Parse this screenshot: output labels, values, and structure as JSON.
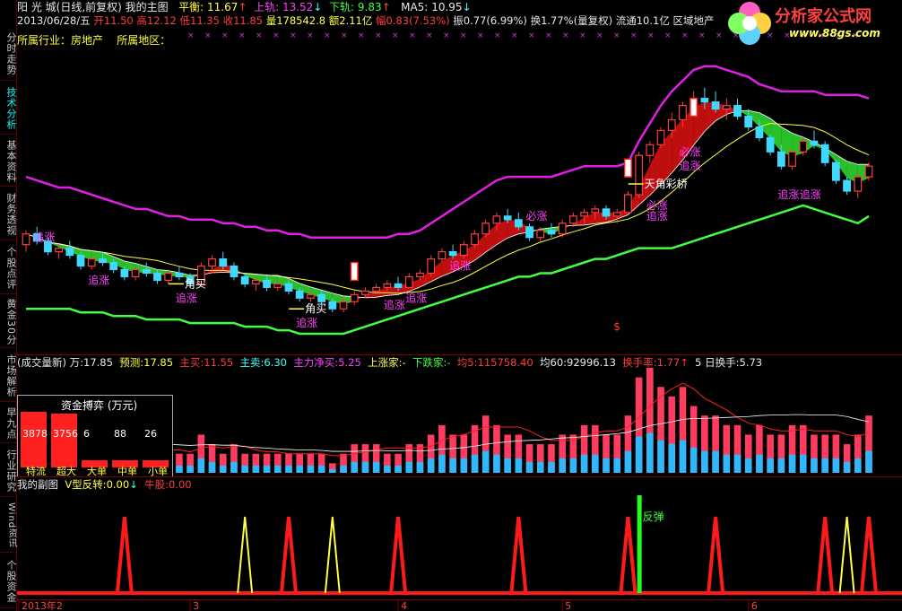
{
  "sidebar": {
    "tabs": [
      {
        "label": "分时走势",
        "active": false
      },
      {
        "label": "技术分析",
        "active": true
      },
      {
        "label": "基本资料",
        "active": false
      },
      {
        "label": "财务透视",
        "active": false
      },
      {
        "label": "个股点评",
        "active": false
      },
      {
        "label": "黄金30分",
        "active": false
      },
      {
        "label": "市场解析",
        "active": false
      },
      {
        "label": "早九点",
        "active": false
      },
      {
        "label": "行业研究",
        "active": false
      },
      {
        "label": "Wind资讯",
        "active": false
      },
      {
        "label": "个股资金",
        "active": false
      }
    ]
  },
  "header": {
    "stock_name": "阳 光 城",
    "mode": "(日线,前复权)",
    "indicator": "我的主图",
    "balance_label": "平衡:",
    "balance_value": "11.67",
    "upper_label": "上轨:",
    "upper_value": "13.52",
    "lower_label": "下轨:",
    "lower_value": "9.83",
    "ma5_label": "MA5:",
    "ma5_value": "10.95",
    "date": "2013/06/28/五",
    "open_label": "开",
    "open_value": "11.50",
    "high_label": "高",
    "high_value": "12.12",
    "low_label": "低",
    "low_value": "11.35",
    "close_label": "收",
    "close_value": "11.85",
    "vol_label": "量",
    "vol_value": "178542.8",
    "amount_label": "额",
    "amount_value": "2.11亿",
    "change_label": "幅",
    "change_value": "0.83(7.53%)",
    "amp_label": "振",
    "amp_value": "0.77(6.99%)",
    "turnover_label": "换",
    "turnover_value": "1.77%(量复权)",
    "float_label": "流通",
    "float_value": "10.1亿",
    "region_label": "区域地产",
    "industry_label": "所属行业：",
    "industry_value": "房地产",
    "area_label": "所属地区："
  },
  "logo": {
    "text": "分析家公式网",
    "url": "www.88gs.com"
  },
  "price_annotations": [
    {
      "text": "追涨",
      "cls": "mag"
    },
    {
      "text": "追涨",
      "cls": "mag"
    },
    {
      "text": "角买",
      "cls": "wht"
    },
    {
      "text": "追涨",
      "cls": "mag"
    },
    {
      "text": "角买",
      "cls": "wht"
    },
    {
      "text": "追涨",
      "cls": "mag"
    },
    {
      "text": "追涨",
      "cls": "mag"
    },
    {
      "text": "追涨",
      "cls": "mag"
    },
    {
      "text": "追涨",
      "cls": "mag"
    },
    {
      "text": "必涨",
      "cls": "mag"
    },
    {
      "text": "天角彩桥",
      "cls": "wht"
    },
    {
      "text": "必涨",
      "cls": "mag"
    },
    {
      "text": "追涨",
      "cls": "mag"
    },
    {
      "text": "必涨",
      "cls": "mag"
    },
    {
      "text": "追涨",
      "cls": "mag"
    },
    {
      "text": "追涨",
      "cls": "mag"
    },
    {
      "text": "追涨",
      "cls": "mag"
    },
    {
      "text": "$",
      "cls": "red"
    }
  ],
  "volume_header": {
    "title": "(成交量新)",
    "wan_label": "万:",
    "wan_value": "17.85",
    "forecast_label": "预测:",
    "forecast_value": "17.85",
    "main_buy_label": "主买:",
    "main_buy_value": "11.55",
    "main_sell_label": "主卖:",
    "main_sell_value": "6.30",
    "net_label": "主力净买:",
    "net_value": "5.25",
    "up_label": "上涨家:",
    "up_value": "-",
    "down_label": "下跌家:",
    "down_value": "-",
    "avg5_label": "均5:",
    "avg5_value": "115758.40",
    "avg60_label": "均60:",
    "avg60_value": "92996.13",
    "turn_label": "换手率:",
    "turn_value": "1.77",
    "turn5_label": "5 日换手:",
    "turn5_value": "5.73"
  },
  "capital_flow": {
    "title": "资金搏弈 (万元)",
    "bars": [
      {
        "label": "特流",
        "value": "3878",
        "amount": 3878
      },
      {
        "label": "超大",
        "value": "3756",
        "amount": 3756
      },
      {
        "label": "大单",
        "value": "6",
        "amount": 6
      },
      {
        "label": "中单",
        "value": "88",
        "amount": 88
      },
      {
        "label": "小单",
        "value": "26",
        "amount": 26
      }
    ]
  },
  "sub_header": {
    "title": "我的副图",
    "vrev_label": "V型反转:",
    "vrev_value": "0.00",
    "bull_label": "牛股:",
    "bull_value": "0.00"
  },
  "sub_annotation": "反弹",
  "x_axis": {
    "labels": [
      "2013年2",
      "3",
      "4",
      "5",
      "6"
    ]
  },
  "colors": {
    "up": "#ff3c3c",
    "down": "#40d8ff",
    "upper_band": "#e020e0",
    "lower_band": "#40ff40",
    "volume_up": "#ff3c60",
    "signal_red": "#ff1a1a",
    "signal_yellow": "#ffff40",
    "grid": "#7a0000"
  },
  "chart_data": {
    "type": "candlestick",
    "candles": [
      [
        9.9,
        10.3,
        9.7,
        10.2
      ],
      [
        10.2,
        10.4,
        9.9,
        10.0
      ],
      [
        10.0,
        10.1,
        9.6,
        9.7
      ],
      [
        9.7,
        9.9,
        9.5,
        9.8
      ],
      [
        9.8,
        10.0,
        9.5,
        9.6
      ],
      [
        9.6,
        9.7,
        9.2,
        9.3
      ],
      [
        9.3,
        9.6,
        9.2,
        9.5
      ],
      [
        9.5,
        9.7,
        9.3,
        9.4
      ],
      [
        9.4,
        9.5,
        9.1,
        9.2
      ],
      [
        9.2,
        9.3,
        8.9,
        9.0
      ],
      [
        9.0,
        9.3,
        8.9,
        9.2
      ],
      [
        9.2,
        9.4,
        9.0,
        9.1
      ],
      [
        9.1,
        9.2,
        8.8,
        8.9
      ],
      [
        8.9,
        9.2,
        8.8,
        9.1
      ],
      [
        9.1,
        9.3,
        8.9,
        9.0
      ],
      [
        9.0,
        9.1,
        8.7,
        8.8
      ],
      [
        8.8,
        9.4,
        8.7,
        9.3
      ],
      [
        9.3,
        9.6,
        9.1,
        9.5
      ],
      [
        9.5,
        9.7,
        9.2,
        9.3
      ],
      [
        9.3,
        9.4,
        8.9,
        9.0
      ],
      [
        9.0,
        9.1,
        8.7,
        8.8
      ],
      [
        8.8,
        9.0,
        8.6,
        8.9
      ],
      [
        8.9,
        9.0,
        8.6,
        8.7
      ],
      [
        8.7,
        8.9,
        8.6,
        8.8
      ],
      [
        8.8,
        8.9,
        8.5,
        8.6
      ],
      [
        8.6,
        8.7,
        8.3,
        8.4
      ],
      [
        8.4,
        8.6,
        8.3,
        8.5
      ],
      [
        8.5,
        8.6,
        8.2,
        8.3
      ],
      [
        8.3,
        8.4,
        8.0,
        8.1
      ],
      [
        8.1,
        8.4,
        8.0,
        8.3
      ],
      [
        8.3,
        8.6,
        8.2,
        8.5
      ],
      [
        8.5,
        8.7,
        8.4,
        8.6
      ],
      [
        8.6,
        8.8,
        8.5,
        8.7
      ],
      [
        8.7,
        8.9,
        8.6,
        8.8
      ],
      [
        8.8,
        9.0,
        8.6,
        8.7
      ],
      [
        8.7,
        9.1,
        8.7,
        9.0
      ],
      [
        9.0,
        9.2,
        8.9,
        9.1
      ],
      [
        9.1,
        9.6,
        9.0,
        9.5
      ],
      [
        9.5,
        9.8,
        9.4,
        9.7
      ],
      [
        9.7,
        9.9,
        9.5,
        9.6
      ],
      [
        9.6,
        10.0,
        9.5,
        9.9
      ],
      [
        9.9,
        10.3,
        9.8,
        10.2
      ],
      [
        10.2,
        10.6,
        10.1,
        10.5
      ],
      [
        10.5,
        10.8,
        10.3,
        10.7
      ],
      [
        10.7,
        10.9,
        10.5,
        10.6
      ],
      [
        10.6,
        10.8,
        10.3,
        10.4
      ],
      [
        10.4,
        10.5,
        10.0,
        10.1
      ],
      [
        10.1,
        10.4,
        10.0,
        10.3
      ],
      [
        10.3,
        10.5,
        10.1,
        10.2
      ],
      [
        10.2,
        10.6,
        10.1,
        10.5
      ],
      [
        10.5,
        10.8,
        10.4,
        10.7
      ],
      [
        10.7,
        10.9,
        10.5,
        10.8
      ],
      [
        10.8,
        11.0,
        10.6,
        10.9
      ],
      [
        10.9,
        11.0,
        10.6,
        10.7
      ],
      [
        10.7,
        10.9,
        10.5,
        10.8
      ],
      [
        10.8,
        11.4,
        10.8,
        11.3
      ],
      [
        11.3,
        12.5,
        11.2,
        12.4
      ],
      [
        12.4,
        12.8,
        12.2,
        12.7
      ],
      [
        12.7,
        13.2,
        12.6,
        13.1
      ],
      [
        13.1,
        13.6,
        12.9,
        13.4
      ],
      [
        13.4,
        13.9,
        13.2,
        13.8
      ],
      [
        13.8,
        14.2,
        13.6,
        14.0
      ],
      [
        14.0,
        14.3,
        13.7,
        13.9
      ],
      [
        13.9,
        14.2,
        13.6,
        13.7
      ],
      [
        13.7,
        14.0,
        13.4,
        13.8
      ],
      [
        13.8,
        14.0,
        13.4,
        13.5
      ],
      [
        13.5,
        13.7,
        13.1,
        13.2
      ],
      [
        13.2,
        13.4,
        12.8,
        12.9
      ],
      [
        12.9,
        13.0,
        12.4,
        12.5
      ],
      [
        12.5,
        12.7,
        12.0,
        12.1
      ],
      [
        12.1,
        12.6,
        12.0,
        12.5
      ],
      [
        12.5,
        12.9,
        12.4,
        12.8
      ],
      [
        12.8,
        13.1,
        12.6,
        12.7
      ],
      [
        12.7,
        12.8,
        12.1,
        12.2
      ],
      [
        12.2,
        12.3,
        11.6,
        11.7
      ],
      [
        11.7,
        11.8,
        11.3,
        11.4
      ],
      [
        11.4,
        11.9,
        11.2,
        11.8
      ],
      [
        11.8,
        12.2,
        11.7,
        12.1
      ]
    ],
    "upper_band": [
      11.8,
      11.7,
      11.6,
      11.5,
      11.5,
      11.4,
      11.3,
      11.2,
      11.1,
      11.0,
      10.9,
      10.9,
      10.8,
      10.7,
      10.7,
      10.6,
      10.6,
      10.6,
      10.5,
      10.5,
      10.4,
      10.4,
      10.3,
      10.3,
      10.2,
      10.2,
      10.1,
      10.1,
      10.1,
      10.1,
      10.1,
      10.1,
      10.1,
      10.1,
      10.2,
      10.2,
      10.3,
      10.5,
      10.7,
      10.9,
      11.1,
      11.3,
      11.5,
      11.7,
      11.8,
      11.8,
      11.8,
      11.8,
      11.8,
      11.9,
      12.0,
      12.1,
      12.1,
      12.1,
      12.1,
      12.2,
      12.8,
      13.3,
      13.8,
      14.2,
      14.5,
      14.8,
      14.9,
      14.9,
      14.8,
      14.7,
      14.6,
      14.4,
      14.3,
      14.2,
      14.2,
      14.2,
      14.2,
      14.1,
      14.1,
      14.1,
      14.1,
      14.0
    ],
    "lower_band": [
      8.1,
      8.1,
      8.1,
      8.1,
      8.1,
      8.0,
      8.0,
      8.0,
      7.9,
      7.9,
      7.9,
      7.8,
      7.8,
      7.8,
      7.8,
      7.7,
      7.7,
      7.7,
      7.7,
      7.7,
      7.6,
      7.6,
      7.6,
      7.5,
      7.5,
      7.4,
      7.4,
      7.4,
      7.4,
      7.4,
      7.5,
      7.6,
      7.7,
      7.8,
      7.9,
      8.0,
      8.1,
      8.2,
      8.3,
      8.4,
      8.5,
      8.6,
      8.7,
      8.8,
      8.9,
      9.0,
      9.0,
      9.1,
      9.1,
      9.2,
      9.3,
      9.4,
      9.5,
      9.5,
      9.6,
      9.7,
      9.8,
      9.8,
      9.8,
      9.8,
      9.9,
      10.0,
      10.1,
      10.2,
      10.3,
      10.4,
      10.5,
      10.6,
      10.7,
      10.8,
      10.9,
      11.0,
      10.9,
      10.8,
      10.7,
      10.6,
      10.5,
      10.7
    ],
    "volume": [
      5,
      4,
      3,
      4,
      3,
      3,
      2,
      3,
      3,
      2,
      3,
      2,
      2,
      3,
      2,
      2,
      4,
      3,
      2,
      3,
      2,
      2,
      2,
      2,
      2,
      2,
      2,
      2,
      1,
      2,
      3,
      3,
      3,
      2,
      2,
      3,
      3,
      4,
      5,
      4,
      4,
      5,
      6,
      5,
      4,
      4,
      3,
      3,
      3,
      4,
      4,
      5,
      5,
      4,
      4,
      6,
      10,
      11,
      9,
      8,
      9,
      7,
      6,
      6,
      5,
      5,
      4,
      5,
      4,
      4,
      5,
      5,
      4,
      4,
      4,
      3,
      4,
      6
    ],
    "subchart_red_peaks": [
      9,
      24,
      34,
      45,
      55,
      63,
      73,
      77
    ],
    "subchart_yellow_peaks": [
      20,
      28,
      75,
      77
    ]
  }
}
